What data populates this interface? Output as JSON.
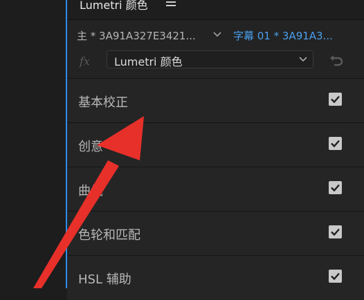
{
  "panel": {
    "title": "Lumetri 颜色",
    "menu_icon": "hamburger-menu-icon"
  },
  "clip": {
    "main": "主 * 3A91A327E3421...",
    "sub": "字幕 01 * 3A91A3...",
    "sub_color": "#4a9fee"
  },
  "effect": {
    "fx_label": "fx",
    "selected": "Lumetri 颜色",
    "reset_icon": "reset-icon"
  },
  "sections": [
    {
      "label": "基本校正",
      "enabled": true
    },
    {
      "label": "创意",
      "enabled": true
    },
    {
      "label": "曲线",
      "enabled": true
    },
    {
      "label": "色轮和匹配",
      "enabled": true
    },
    {
      "label": "HSL 辅助",
      "enabled": true
    }
  ],
  "colors": {
    "accent": "#2d8ceb",
    "annotation_arrow": "#e8302a"
  }
}
